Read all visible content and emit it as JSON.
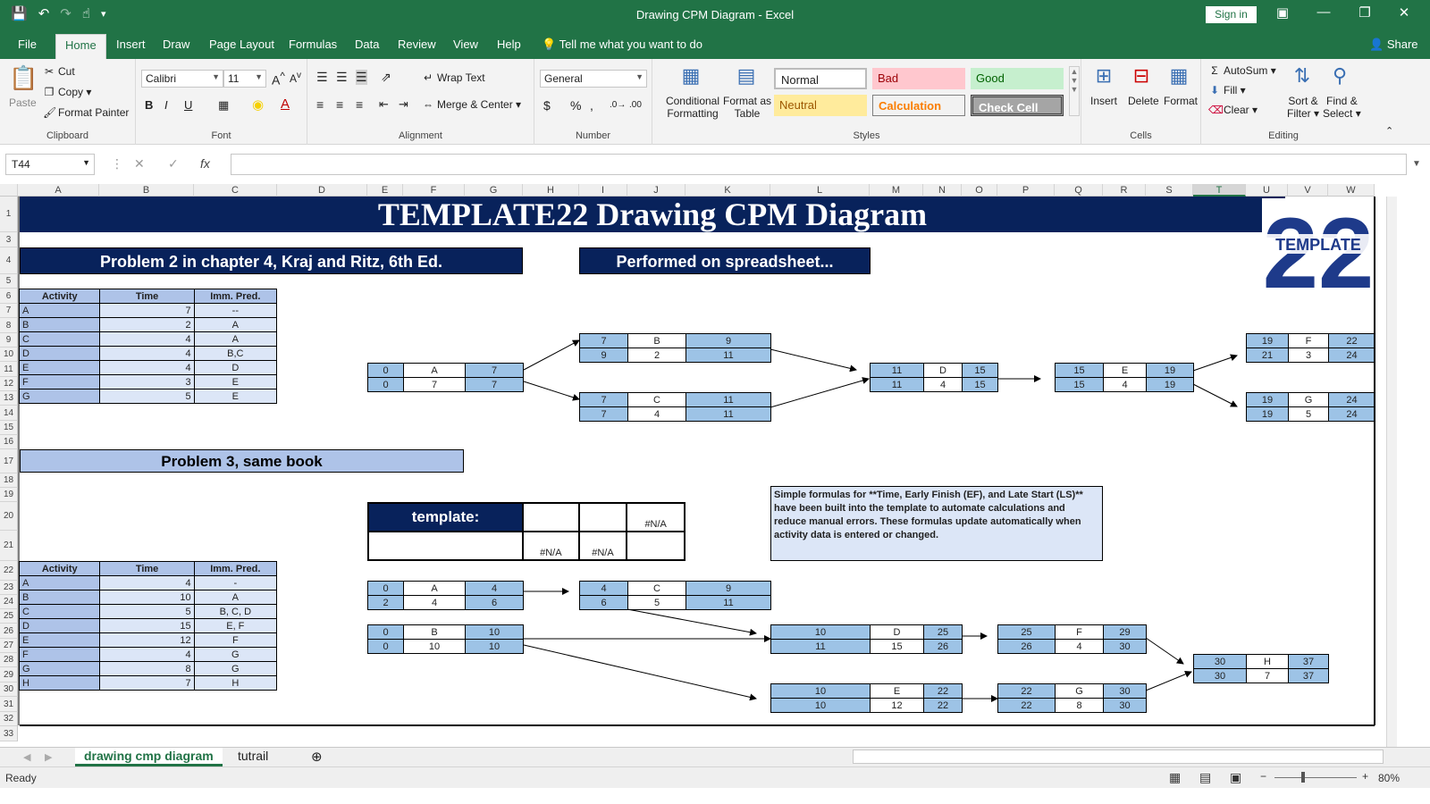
{
  "window": {
    "title": "Drawing CPM Diagram  -  Excel",
    "sign_in": "Sign in"
  },
  "icons": {
    "save": "save-icon",
    "undo": "undo-icon",
    "redo": "redo-icon",
    "touch": "touch-mode-icon",
    "customize": "customize-qat-icon"
  },
  "tabs": [
    "File",
    "Home",
    "Insert",
    "Draw",
    "Page Layout",
    "Formulas",
    "Data",
    "Review",
    "View",
    "Help"
  ],
  "active_tab": "Home",
  "tell_me": "Tell me what you want to do",
  "share": "Share",
  "clipboard": {
    "paste": "Paste",
    "cut": "Cut",
    "copy": "Copy",
    "format_painter": "Format Painter",
    "label": "Clipboard"
  },
  "font": {
    "name": "Calibri",
    "size": "11",
    "bold": "B",
    "italic": "I",
    "underline": "U",
    "label": "Font"
  },
  "alignment": {
    "wrap_text": "Wrap Text",
    "merge_center": "Merge & Center",
    "label": "Alignment"
  },
  "number": {
    "format": "General",
    "currency": "$",
    "percent": "%",
    "comma": ",",
    "label": "Number"
  },
  "styles": {
    "conditional": "Conditional",
    "conditional2": "Formatting",
    "format_as": "Format as",
    "format_as2": "Table",
    "normal": "Normal",
    "bad": "Bad",
    "good": "Good",
    "neutral": "Neutral",
    "calculation": "Calculation",
    "check_cell": "Check Cell",
    "label": "Styles"
  },
  "cells_group": {
    "insert": "Insert",
    "delete": "Delete",
    "format": "Format",
    "label": "Cells"
  },
  "editing": {
    "autosum": "AutoSum",
    "fill": "Fill",
    "clear": "Clear",
    "sort": "Sort &",
    "sort2": "Filter",
    "find": "Find &",
    "find2": "Select",
    "label": "Editing"
  },
  "formula_bar": {
    "name_box": "T44",
    "cancel": "✕",
    "enter": "✓",
    "fx": "fx",
    "content": ""
  },
  "columns": [
    "A",
    "B",
    "C",
    "D",
    "E",
    "F",
    "G",
    "H",
    "I",
    "J",
    "K",
    "L",
    "M",
    "N",
    "O",
    "P",
    "Q",
    "R",
    "S",
    "T",
    "U",
    "V",
    "W"
  ],
  "rows": [
    "1",
    "3",
    "4",
    "5",
    "6",
    "7",
    "8",
    "9",
    "10",
    "11",
    "12",
    "13",
    "14",
    "15",
    "16",
    "17",
    "18",
    "19",
    "20",
    "21",
    "22",
    "23",
    "24",
    "25",
    "26",
    "27",
    "28",
    "29",
    "30",
    "31",
    "32",
    "33"
  ],
  "sheet": {
    "banner": "TEMPLATE22 Drawing CPM Diagram",
    "logo_text": "TEMPLATE",
    "logo_number": "22",
    "problem2": "Problem 2 in chapter 4, Kraj and Ritz, 6th Ed.",
    "performed": "Performed on spreadsheet...",
    "problem3": "Problem 3, same book",
    "table1": {
      "headers": [
        "Activity",
        "Time",
        "Imm. Pred."
      ],
      "rows": [
        [
          "A",
          "7",
          "--"
        ],
        [
          "B",
          "2",
          "A"
        ],
        [
          "C",
          "4",
          "A"
        ],
        [
          "D",
          "4",
          "B,C"
        ],
        [
          "E",
          "4",
          "D"
        ],
        [
          "F",
          "3",
          "E"
        ],
        [
          "G",
          "5",
          "E"
        ]
      ]
    },
    "table2": {
      "headers": [
        "Activity",
        "Time",
        "Imm. Pred."
      ],
      "rows": [
        [
          "A",
          "4",
          "-"
        ],
        [
          "B",
          "10",
          "A"
        ],
        [
          "C",
          "5",
          "B, C, D"
        ],
        [
          "D",
          "15",
          "E, F"
        ],
        [
          "E",
          "12",
          "F"
        ],
        [
          "F",
          "4",
          "G"
        ],
        [
          "G",
          "8",
          "G"
        ],
        [
          "H",
          "7",
          "H"
        ]
      ]
    },
    "nodes1": [
      {
        "top": [
          "0",
          "A",
          "7"
        ],
        "bot": [
          "0",
          "7",
          "7"
        ]
      },
      {
        "top": [
          "7",
          "B",
          "9"
        ],
        "bot": [
          "9",
          "2",
          "11"
        ]
      },
      {
        "top": [
          "7",
          "C",
          "11"
        ],
        "bot": [
          "7",
          "4",
          "11"
        ]
      },
      {
        "top": [
          "11",
          "D",
          "15"
        ],
        "bot": [
          "11",
          "4",
          "15"
        ]
      },
      {
        "top": [
          "15",
          "E",
          "19"
        ],
        "bot": [
          "15",
          "4",
          "19"
        ]
      },
      {
        "top": [
          "19",
          "F",
          "22"
        ],
        "bot": [
          "21",
          "3",
          "24"
        ]
      },
      {
        "top": [
          "19",
          "G",
          "24"
        ],
        "bot": [
          "19",
          "5",
          "24"
        ]
      }
    ],
    "nodes2": [
      {
        "top": [
          "0",
          "A",
          "4"
        ],
        "bot": [
          "2",
          "4",
          "6"
        ]
      },
      {
        "top": [
          "0",
          "B",
          "10"
        ],
        "bot": [
          "0",
          "10",
          "10"
        ]
      },
      {
        "top": [
          "4",
          "C",
          "9"
        ],
        "bot": [
          "6",
          "5",
          "11"
        ]
      },
      {
        "top": [
          "10",
          "D",
          "25"
        ],
        "bot": [
          "11",
          "15",
          "26"
        ]
      },
      {
        "top": [
          "10",
          "E",
          "22"
        ],
        "bot": [
          "10",
          "12",
          "22"
        ]
      },
      {
        "top": [
          "25",
          "F",
          "29"
        ],
        "bot": [
          "26",
          "4",
          "30"
        ]
      },
      {
        "top": [
          "22",
          "G",
          "30"
        ],
        "bot": [
          "22",
          "8",
          "30"
        ]
      },
      {
        "top": [
          "30",
          "H",
          "37"
        ],
        "bot": [
          "30",
          "7",
          "37"
        ]
      }
    ],
    "template_label": "template:",
    "na": "#N/A",
    "note": "Simple formulas for **Time, Early Finish (EF), and Late Start (LS)** have been built into the template to automate calculations and reduce manual errors. These formulas update automatically when activity data is entered or changed."
  },
  "sheet_tabs": [
    "drawing cmp diagram",
    "tutrail"
  ],
  "status": {
    "ready": "Ready",
    "zoom": "80%"
  },
  "colors": {
    "excel_green": "#217346",
    "navy": "#08225b",
    "light_blue": "#aec3e8",
    "node_blue": "#9dc3e6"
  }
}
